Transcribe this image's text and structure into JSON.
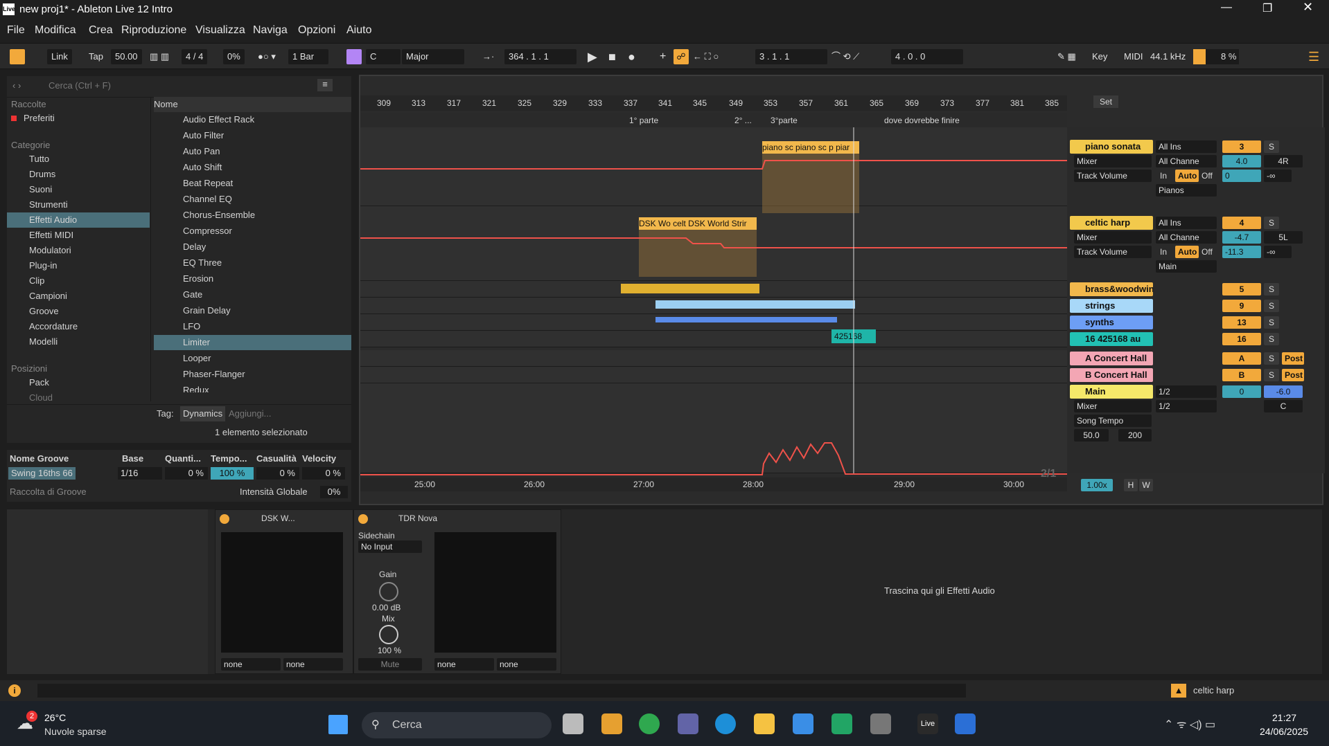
{
  "window": {
    "title": "new proj1* - Ableton Live 12 Intro"
  },
  "menu": [
    "File",
    "Modifica",
    "Crea",
    "Riproduzione",
    "Visualizza",
    "Naviga",
    "Opzioni",
    "Aiuto"
  ],
  "control": {
    "link": "Link",
    "tap": "Tap",
    "tempo": "50.00",
    "sig": "4 / 4",
    "swing": "0%",
    "quant": "1 Bar",
    "key": "C",
    "scale": "Major",
    "pos": "364 .  1 .  1",
    "loop_start": "3 .  1 .  1",
    "loop_len": "4 .  0 .  0",
    "keybtn": "Key",
    "midi": "MIDI",
    "rate": "44.1 kHz",
    "cpu": "8 %"
  },
  "browser": {
    "search": "Cerca (Ctrl + F)",
    "col": "Nome",
    "sec1": "Raccolte",
    "fav": "Preferiti",
    "sec2": "Categorie",
    "cats": [
      "Tutto",
      "Drums",
      "Suoni",
      "Strumenti",
      "Effetti Audio",
      "Effetti MIDI",
      "Modulatori",
      "Plug-in",
      "Clip",
      "Campioni",
      "Groove",
      "Accordature",
      "Modelli"
    ],
    "sec3": "Posizioni",
    "places": [
      "Pack",
      "Cloud"
    ],
    "items": [
      "Audio Effect Rack",
      "Auto Filter",
      "Auto Pan",
      "Auto Shift",
      "Beat Repeat",
      "Channel EQ",
      "Chorus-Ensemble",
      "Compressor",
      "Delay",
      "EQ Three",
      "Erosion",
      "Gate",
      "Grain Delay",
      "LFO",
      "Limiter",
      "Looper",
      "Phaser-Flanger",
      "Redux"
    ],
    "tag": "Tag:",
    "tagval": "Dynamics",
    "tagadd": "Aggiungi...",
    "status": "1 elemento selezionato"
  },
  "groove": {
    "h": [
      "Nome Groove",
      "Base",
      "Quanti...",
      "Tempo...",
      "Casualità",
      "Velocity"
    ],
    "name": "Swing 16ths 66",
    "base": "1/16",
    "q": "0 %",
    "t": "100 %",
    "c": "0 %",
    "v": "0 %",
    "pool": "Raccolta di Groove",
    "global": "Intensità Globale",
    "gval": "0%"
  },
  "ruler": [
    "309",
    "313",
    "317",
    "321",
    "325",
    "329",
    "333",
    "337",
    "341",
    "345",
    "349",
    "353",
    "357",
    "361",
    "365",
    "369",
    "373",
    "377",
    "381",
    "385"
  ],
  "time": [
    "25:00",
    "26:00",
    "27:00",
    "28:00",
    "29:00",
    "30:00"
  ],
  "locators": [
    "1° parte",
    "2° ...",
    "3°parte",
    "dove dovrebbe finire"
  ],
  "set": "Set",
  "clips": {
    "p1": "piano sc",
    "p2": "piano sc",
    "p3": "p",
    "p4": "piar",
    "h1": "DSK Wo",
    "h2": "celt",
    "h3": "DSK World Strir",
    "a1": "425168"
  },
  "tracks": [
    {
      "name": "piano sonata",
      "color": "#f2c94c",
      "in": "All Ins",
      "num": "3",
      "mix": "Mixer",
      "ch": "All Channe",
      "vol": "4.0",
      "pan": "4R",
      "auto": "Track Volume",
      "inb": "In",
      "autob": "Auto",
      "off": "Off",
      "send": "0",
      "inf": "-∞",
      "out": "Pianos"
    },
    {
      "name": "celtic harp",
      "color": "#f2c94c",
      "in": "All Ins",
      "num": "4",
      "mix": "Mixer",
      "ch": "All Channe",
      "vol": "-4.7",
      "pan": "5L",
      "auto": "Track Volume",
      "inb": "In",
      "autob": "Auto",
      "off": "Off",
      "send": "-11.3",
      "inf": "-∞",
      "out": "Main"
    },
    {
      "name": "brass&woodwin",
      "color": "#f2b84c",
      "num": "5"
    },
    {
      "name": "strings",
      "color": "#a8d8f8",
      "num": "9"
    },
    {
      "name": "synths",
      "color": "#6d9ef5",
      "num": "13"
    },
    {
      "name": "16 425168 au",
      "color": "#22c1b4",
      "num": "16"
    },
    {
      "name": "A Concert Hall",
      "color": "#f3a6b4",
      "num": "A",
      "post": "Post"
    },
    {
      "name": "B Concert Hall",
      "color": "#f3a6b4",
      "num": "B",
      "post": "Post"
    },
    {
      "name": "Main",
      "color": "#f5e86a",
      "in": "1/2",
      "num": "0",
      "vol": "-6.0",
      "mix": "Mixer",
      "in2": "1/2",
      "pan": "C",
      "auto": "Song Tempo",
      "lo": "50.0",
      "hi": "200"
    }
  ],
  "solo": "S",
  "zoom": "1.00x",
  "hbtn": "H",
  "wbtn": "W",
  "page": "2/1",
  "devices": {
    "d1": "DSK W...",
    "d2": "TDR Nova",
    "side": "Sidechain",
    "noin": "No Input",
    "gain": "Gain",
    "gval": "0.00 dB",
    "mix": "Mix",
    "mval": "100 %",
    "mute": "Mute",
    "none": "none",
    "drop": "Trascina qui gli Effetti Audio"
  },
  "status": {
    "track": "celtic harp"
  },
  "taskbar": {
    "temp": "26°C",
    "weather": "Nuvole sparse",
    "badge": "2",
    "search": "Cerca",
    "time": "21:27",
    "date": "24/06/2025"
  }
}
